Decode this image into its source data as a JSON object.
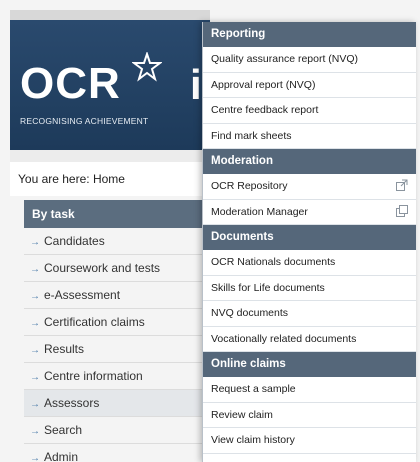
{
  "banner": {
    "logo_text": "OCR",
    "logo_suffix": "in",
    "tagline": "RECOGNISING ACHIEVEMENT"
  },
  "breadcrumb": "You are here: Home",
  "nav": {
    "heading": "By task",
    "items": [
      {
        "label": "Candidates"
      },
      {
        "label": "Coursework and tests"
      },
      {
        "label": "e-Assessment"
      },
      {
        "label": "Certification claims"
      },
      {
        "label": "Results"
      },
      {
        "label": "Centre information"
      },
      {
        "label": "Assessors"
      },
      {
        "label": "Search"
      },
      {
        "label": "Admin"
      }
    ]
  },
  "menu": {
    "sections": [
      {
        "title": "Reporting",
        "items": [
          {
            "label": "Quality assurance report (NVQ)"
          },
          {
            "label": "Approval report (NVQ)"
          },
          {
            "label": "Centre feedback report"
          },
          {
            "label": "Find mark sheets"
          }
        ]
      },
      {
        "title": "Moderation",
        "items": [
          {
            "label": "OCR Repository",
            "icon": "external-link-icon"
          },
          {
            "label": "Moderation Manager",
            "icon": "external-link-icon"
          }
        ]
      },
      {
        "title": "Documents",
        "items": [
          {
            "label": "OCR Nationals documents"
          },
          {
            "label": "Skills for Life documents"
          },
          {
            "label": "NVQ documents"
          },
          {
            "label": "Vocationally related documents"
          }
        ]
      },
      {
        "title": "Online claims",
        "items": [
          {
            "label": "Request a sample"
          },
          {
            "label": "Review claim"
          },
          {
            "label": "View claim history"
          }
        ]
      }
    ]
  },
  "colors": {
    "banner": "#1d3a5a",
    "section_header": "#55677a",
    "nav_header": "#5b6d7f",
    "arrow": "#4a7aa8"
  }
}
